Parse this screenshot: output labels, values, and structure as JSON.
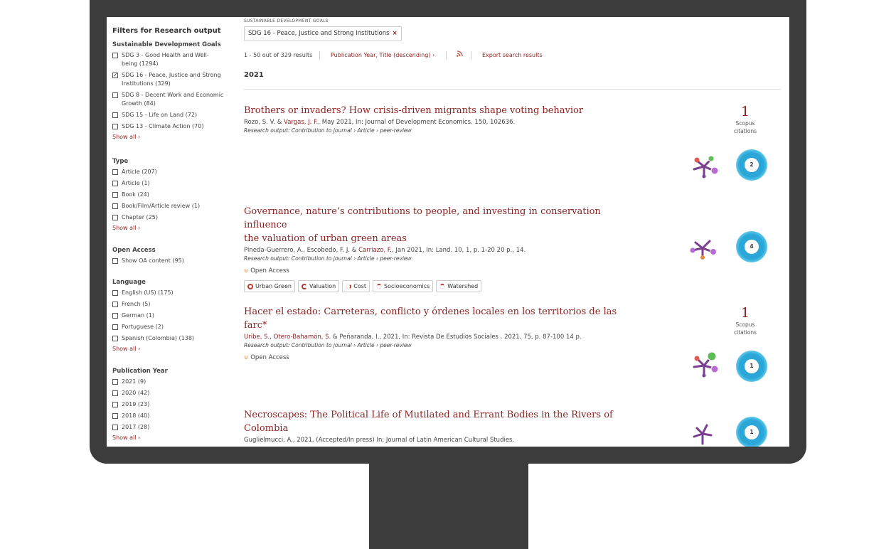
{
  "filters": {
    "title": "Filters for Research output",
    "sdg": {
      "heading": "Sustainable Development Goals",
      "items": [
        {
          "line1": "SDG 3 - Good Health and Well-",
          "line2": "being (1294)",
          "checked": false
        },
        {
          "line1": "SDG 16 - Peace, Justice and Strong",
          "line2": "Institutions (329)",
          "checked": true
        },
        {
          "line1": "SDG 8 - Decent Work and Economic",
          "line2": "Growth (84)",
          "checked": false
        },
        {
          "line1": "SDG 15 - Life on Land (72)",
          "line2": "",
          "checked": false
        },
        {
          "line1": "SDG 13 - Climate Action (70)",
          "line2": "",
          "checked": false
        }
      ],
      "show_all": "Show all ›"
    },
    "type": {
      "heading": "Type",
      "items": [
        "Article (207)",
        "Article (1)",
        "Book (24)",
        "Book/Film/Article review (1)",
        "Chapter (25)"
      ],
      "show_all": "Show all ›"
    },
    "open_access": {
      "heading": "Open Access",
      "items": [
        "Show OA content (95)"
      ]
    },
    "language": {
      "heading": "Language",
      "items": [
        "English (US) (175)",
        "French (5)",
        "German (1)",
        "Portuguese (2)",
        "Spanish (Colombia) (138)"
      ],
      "show_all": "Show all ›"
    },
    "year": {
      "heading": "Publication Year",
      "items": [
        "2021 (9)",
        "2020 (42)",
        "2019 (23)",
        "2018 (40)",
        "2017 (28)"
      ],
      "show_all": "Show all ›"
    }
  },
  "active_filter": {
    "label": "SUSTAINABLE DEVELOPMENT GOALS",
    "chip": "SDG 16 - Peace, Justice and Strong Institutions",
    "remove": "×"
  },
  "results_bar": {
    "count": "1 - 50 out of 329 results",
    "sort": "Publication Year, Title (descending) ›",
    "rss_icon": "rss-icon",
    "export": "Export search results"
  },
  "year_heading": "2021",
  "results": [
    {
      "title": "Brothers or invaders? How crisis-driven migrants shape voting behavior",
      "author_a": "Rozo, S. V. & ",
      "author_link": "Vargas, J. F.",
      "author_b": ", May 2021, In: Journal of Development Economics. 150, 102636.",
      "type": "Research output: Contribution to journal › Article › peer-review",
      "citations": "1",
      "citations_label_1": "Scopus",
      "citations_label_2": "citations",
      "altmetric": "2"
    },
    {
      "title_line1": "Governance, nature’s contributions to people, and investing in conservation influence",
      "title_line2": "the valuation of urban green areas",
      "author_a": "Pineda-Guerrero, A., Escobedo, F. J. & ",
      "author_link": "Carriazo, F.",
      "author_b": ", Jan 2021, In: Land. 10, 1, p. 1-20 20 p., 14.",
      "type": "Research output: Contribution to journal › Article › peer-review",
      "open_access": "Open Access",
      "tags": [
        "Urban Green",
        "Valuation",
        "Cost",
        "Socioeconomics",
        "Watershed"
      ],
      "altmetric": "4"
    },
    {
      "title": "Hacer el estado: Carreteras, conflicto y órdenes locales en los territorios de las farc*",
      "author_link1": "Uribe, S.",
      "author_sep": ", ",
      "author_link2": "Otero-Bahamón, S.",
      "author_b": " & Peñaranda, I., 2021, In: Revista De Estudios Sociales . 2021, 75, p. 87-100 14 p.",
      "type": "Research output: Contribution to journal › Article › peer-review",
      "open_access": "Open Access",
      "citations": "1",
      "citations_label_1": "Scopus",
      "citations_label_2": "citations",
      "altmetric": "1"
    },
    {
      "title_line1": "Necroscapes: The Political Life of Mutilated and Errant Bodies in the Rivers of",
      "title_line2": "Colombia",
      "author_b": "Guglielmucci, A., 2021, (Accepted/In press) In: Journal of Latin American Cultural Studies.",
      "altmetric": "1"
    }
  ],
  "colors": {
    "accent": "#8a1f1f",
    "monitor": "#3c3c3c",
    "altmetric": "#2aa7d8",
    "plum_purple": "#7b3f8f"
  }
}
